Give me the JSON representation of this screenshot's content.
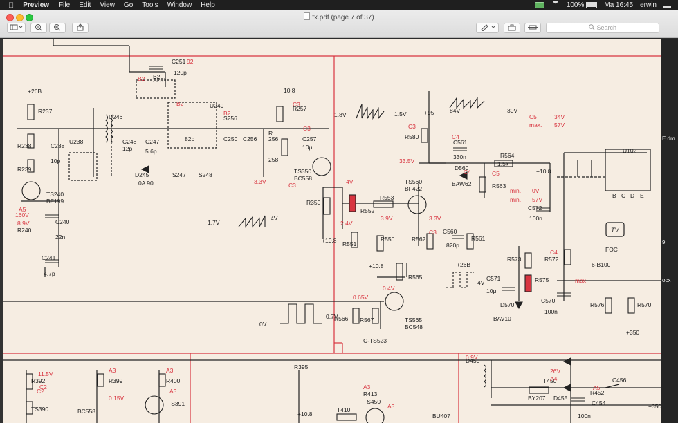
{
  "menubar": {
    "app": "Preview",
    "items": [
      "File",
      "Edit",
      "View",
      "Go",
      "Tools",
      "Window",
      "Help"
    ],
    "battery": "100%",
    "clock": "Ma 16:45",
    "user": "erwin"
  },
  "window": {
    "title": "tx.pdf (page 7 of 37)",
    "search_placeholder": "Search"
  },
  "schematic": {
    "labels_black": [
      "C251",
      "120p",
      "S251",
      "B2",
      "U249",
      "82p",
      "S256",
      "C250",
      "C256",
      "C257",
      "10μ",
      "R257",
      "+10.8",
      "R",
      "256",
      "258",
      "U246",
      "C248",
      "12p",
      "C247",
      "5.6p",
      "D245",
      "0A 90",
      "S247",
      "S248",
      "TS350",
      "BC558",
      "R350",
      "+10.8",
      "U238",
      "C238",
      "10p",
      "R237",
      "+26B",
      "R238",
      "R239",
      "TS240",
      "BF199",
      "R240",
      "C240",
      "22n",
      "C241",
      "4.7p",
      "R580",
      "+95",
      "84V",
      "30V",
      "C561",
      "330n",
      "D560",
      "BAW62",
      "R564",
      "1.5k",
      "+10.8",
      "U102",
      "B",
      "C",
      "D",
      "E",
      "TS560",
      "BF422",
      "R553",
      "R552",
      "R550",
      "R551",
      "+10.8",
      "R562",
      "C560",
      "820p",
      "R561",
      "+26B",
      "R563",
      "C572",
      "100n",
      "R573",
      "R572",
      "R575",
      "C571",
      "10μ",
      "D570",
      "BAV10",
      "C570",
      "100n",
      "R576",
      "R570",
      "+350",
      "FOC",
      "6-B100",
      "TS565",
      "BC548",
      "R565",
      "R566",
      "R567",
      "C-TS523",
      "1.8V",
      "1.5V",
      "1.7V",
      "4V",
      "0V",
      "0.7V",
      "4V",
      "R392",
      "R399",
      "R400",
      "TS391",
      "BC558",
      "TS390",
      "R395",
      "+10.8",
      "T410",
      "R413",
      "TS450",
      "BU407",
      "D450",
      "T450",
      "D455",
      "BY207",
      "R452",
      "C454",
      "100n",
      "C456",
      "+350",
      "D"
    ],
    "labels_red": [
      "92",
      "B2",
      "B2",
      "B2",
      "C3",
      "C3",
      "3.3V",
      "C3",
      "4V",
      "2.4V",
      "3.9V",
      "33.5V",
      "3.3V",
      "0.4V",
      "0.65V",
      "C3",
      "C3",
      "C4",
      "C4",
      "C5",
      "C4",
      "C5",
      "34V",
      "max.",
      "57V",
      "min.",
      "0V",
      "min.",
      "57V",
      "max",
      "160V",
      "8.9V",
      "C2",
      "C2",
      "0.15V",
      "11.5V",
      "A3",
      "A3",
      "A3",
      "A3",
      "A3",
      "0.9V",
      "26V",
      "A4",
      "A5",
      "A5",
      "B4",
      "C2"
    ],
    "ellipsis_right": [
      "E.dm",
      "9.",
      "ocx"
    ]
  }
}
